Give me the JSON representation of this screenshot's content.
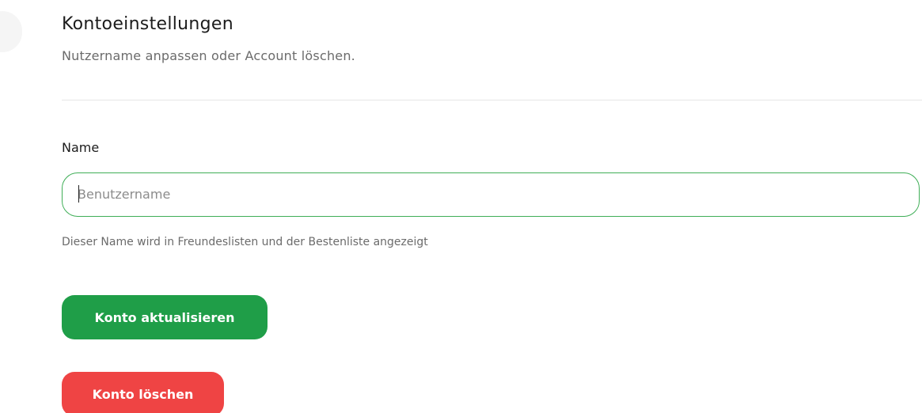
{
  "header": {
    "title": "Kontoeinstellungen",
    "subtitle": "Nutzername anpassen oder Account löschen."
  },
  "form": {
    "name_label": "Name",
    "name_value": "",
    "name_placeholder": "Benutzername",
    "name_helper": "Dieser Name wird in Freundeslisten und der Bestenliste angezeigt"
  },
  "actions": {
    "update_label": "Konto aktualisieren",
    "delete_label": "Konto löschen"
  },
  "colors": {
    "accent_green": "#1f9e48",
    "focus_border": "#3fae57",
    "danger_red": "#ef4444"
  }
}
